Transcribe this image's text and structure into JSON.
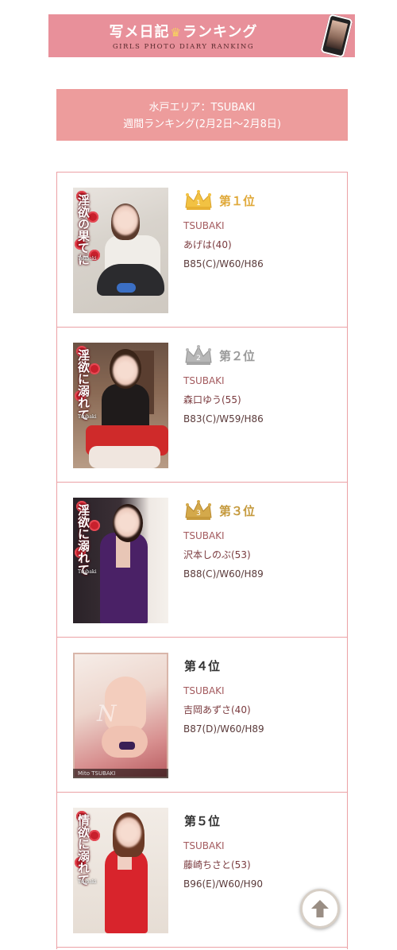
{
  "banner": {
    "title_pre": "写メ日記",
    "title_post": "ランキング",
    "crown_glyph": "♛",
    "subtitle": "GIRLS PHOTO DIARY RANKING"
  },
  "area": {
    "line1": "水戸エリア：TSUBAKI",
    "line2": "週間ランキング(2月2日〜2月8日)"
  },
  "colors": {
    "accent": "#ed9c9c",
    "border": "#eba1a5",
    "gold": "#e0a93a",
    "silver": "#9a9a9a",
    "bronze": "#c59a3e"
  },
  "ranking": [
    {
      "rank": "第１位",
      "crown": "gold",
      "shop": "TSUBAKI",
      "name": "あげは(40)",
      "size": "B85(C)/W60/H86",
      "photo_text": "淫欲の果てに",
      "photo_sub": "Tsubaki"
    },
    {
      "rank": "第２位",
      "crown": "silver",
      "shop": "TSUBAKI",
      "name": "森口ゆう(55)",
      "size": "B83(C)/W59/H86",
      "photo_text": "淫欲に溺れて",
      "photo_sub": "Tsubaki"
    },
    {
      "rank": "第３位",
      "crown": "bronze",
      "shop": "TSUBAKI",
      "name": "沢本しのぶ(53)",
      "size": "B88(C)/W60/H89",
      "photo_text": "淫欲に溺れて",
      "photo_sub": "Tsubaki"
    },
    {
      "rank": "第４位",
      "crown": "none",
      "shop": "TSUBAKI",
      "name": "吉岡あずさ(40)",
      "size": "B87(D)/W60/H89",
      "photo_text": "",
      "photo_sub": "Mito TSUBAKI"
    },
    {
      "rank": "第５位",
      "crown": "none",
      "shop": "TSUBAKI",
      "name": "藤崎ちさと(53)",
      "size": "B96(E)/W60/H90",
      "photo_text": "情欲に溺れて",
      "photo_sub": "Tsubaki"
    }
  ],
  "icons": {
    "scroll_top": "arrow-up-icon"
  }
}
